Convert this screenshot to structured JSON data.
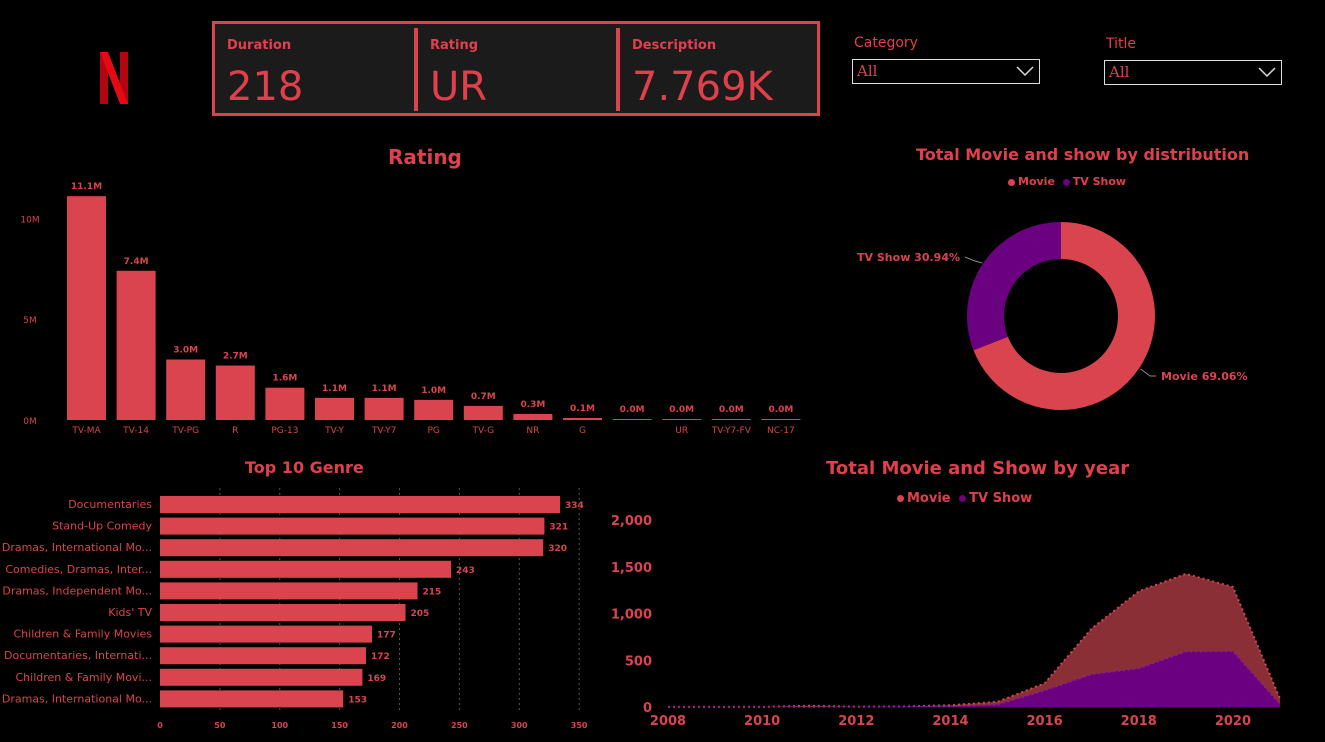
{
  "kpis": [
    {
      "label": "Duration",
      "value": "218"
    },
    {
      "label": "Rating",
      "value": "UR"
    },
    {
      "label": "Description",
      "value": "7.769K"
    }
  ],
  "filters": {
    "category": {
      "label": "Category",
      "value": "All"
    },
    "title": {
      "label": "Title",
      "value": "All"
    }
  },
  "colors": {
    "movie": "#d9444f",
    "tv_show": "#6b0080",
    "background": "#000000"
  },
  "chart_data": [
    {
      "type": "bar",
      "title": "Rating",
      "categories": [
        "TV-MA",
        "TV-14",
        "TV-PG",
        "R",
        "PG-13",
        "TV-Y",
        "TV-Y7",
        "PG",
        "TV-G",
        "NR",
        "G",
        "",
        "UR",
        "TV-Y7-FV",
        "NC-17"
      ],
      "values": [
        11.1,
        7.4,
        3.0,
        2.7,
        1.6,
        1.1,
        1.1,
        1.0,
        0.7,
        0.3,
        0.1,
        0.0,
        0.0,
        0.0,
        0.0
      ],
      "data_labels": [
        "11.1M",
        "7.4M",
        "3.0M",
        "2.7M",
        "1.6M",
        "1.1M",
        "1.1M",
        "1.0M",
        "0.7M",
        "0.3M",
        "0.1M",
        "0.0M",
        "0.0M",
        "0.0M",
        "0.0M"
      ],
      "yticks": [
        "0M",
        "5M",
        "10M"
      ],
      "ylim": [
        0,
        12
      ]
    },
    {
      "type": "pie",
      "title": "Total Movie and show by distribution",
      "legend": [
        "Movie",
        "TV Show"
      ],
      "slices": [
        {
          "name": "Movie",
          "value": 69.06,
          "label": "Movie 69.06%"
        },
        {
          "name": "TV Show",
          "value": 30.94,
          "label": "TV Show 30.94%"
        }
      ]
    },
    {
      "type": "bar",
      "title": "Top 10 Genre",
      "orientation": "horizontal",
      "categories": [
        "Documentaries",
        "Stand-Up Comedy",
        "Dramas, International Mo...",
        "Comedies, Dramas, Inter...",
        "Dramas, Independent Mo...",
        "Kids' TV",
        "Children & Family Movies",
        "Documentaries, Internati...",
        "Children & Family Movi...",
        "Dramas, International Mo..."
      ],
      "values": [
        334,
        321,
        320,
        243,
        215,
        205,
        177,
        172,
        169,
        153
      ],
      "xticks": [
        "0",
        "50",
        "100",
        "150",
        "200",
        "250",
        "300",
        "350"
      ],
      "xlim": [
        0,
        350
      ]
    },
    {
      "type": "area",
      "title": "Total Movie and Show by year",
      "legend": [
        "Movie",
        "TV Show"
      ],
      "x": [
        2008,
        2009,
        2010,
        2011,
        2012,
        2013,
        2014,
        2015,
        2016,
        2017,
        2018,
        2019,
        2020,
        2021
      ],
      "series": [
        {
          "name": "Movie",
          "values": [
            2,
            2,
            1,
            13,
            3,
            6,
            19,
            56,
            253,
            839,
            1237,
            1424,
            1284,
            88
          ]
        },
        {
          "name": "TV Show",
          "values": [
            1,
            1,
            1,
            1,
            1,
            5,
            5,
            26,
            176,
            349,
            412,
            592,
            595,
            29
          ]
        }
      ],
      "yticks": [
        "0",
        "500",
        "1,000",
        "1,500",
        "2,000"
      ],
      "xticks": [
        "2008",
        "2010",
        "2012",
        "2014",
        "2016",
        "2018",
        "2020"
      ],
      "ylim": [
        0,
        2000
      ]
    }
  ]
}
